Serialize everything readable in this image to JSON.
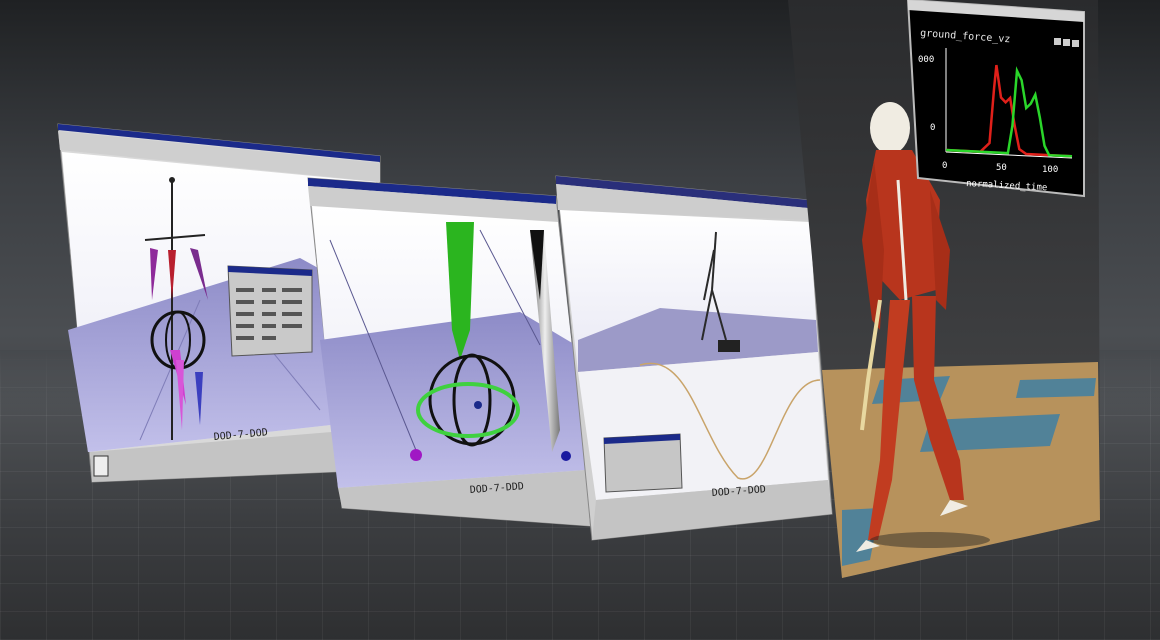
{
  "windows": [
    {
      "id": "win-skeleton-editor",
      "status": "DOD-7-DOD"
    },
    {
      "id": "win-joint-manipulator",
      "status": "DOD-7-DDD"
    },
    {
      "id": "win-motion-curve",
      "status": "DOD-7-DOD"
    }
  ],
  "plot": {
    "title": "ground_force_vz",
    "y_ticks": [
      "000",
      "0"
    ],
    "x_ticks": [
      "0",
      "50",
      "100"
    ],
    "xlabel": "normalized_time"
  },
  "colors": {
    "title_bar": "#1b2a8a",
    "viewport_floor": "#b4b2e0",
    "series_red": "#e0201a",
    "series_green": "#2ad62a",
    "muscle": "#b8351d"
  },
  "chart_data": {
    "type": "line",
    "title": "ground_force_vz",
    "xlabel": "normalized_time",
    "ylabel": "",
    "xlim": [
      0,
      110
    ],
    "series": [
      {
        "values_x": [
          0,
          30,
          38,
          42,
          44,
          48,
          52,
          56,
          60,
          64,
          70,
          110
        ],
        "values": [
          0,
          0,
          0.1,
          0.7,
          0.95,
          0.6,
          0.55,
          0.6,
          0.3,
          0.05,
          0,
          0
        ]
      },
      {
        "values_x": [
          0,
          54,
          58,
          62,
          66,
          70,
          74,
          78,
          82,
          86,
          90,
          110
        ],
        "values": [
          0,
          0,
          0.3,
          0.9,
          0.8,
          0.5,
          0.55,
          0.65,
          0.4,
          0.1,
          0,
          0
        ]
      }
    ]
  }
}
